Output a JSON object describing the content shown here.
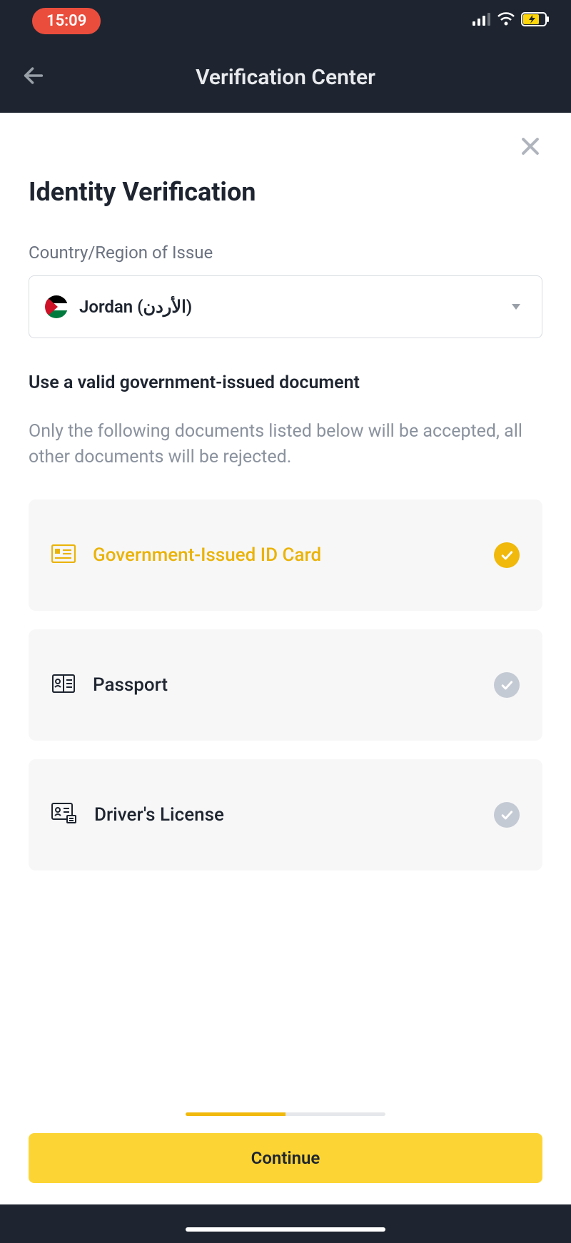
{
  "status_bar": {
    "time": "15:09"
  },
  "nav": {
    "title": "Verification Center"
  },
  "page": {
    "title": "Identity Verification",
    "country_label": "Country/Region of Issue",
    "country_value": "Jordan (الأردن)",
    "section_title": "Use a valid government-issued document",
    "section_desc": "Only the following documents listed below will be accepted, all other documents will be rejected."
  },
  "documents": [
    {
      "label": "Government-Issued ID Card",
      "selected": true
    },
    {
      "label": "Passport",
      "selected": false
    },
    {
      "label": "Driver's License",
      "selected": false
    }
  ],
  "footer": {
    "continue_label": "Continue",
    "progress_pct": 50
  },
  "colors": {
    "accent_yellow": "#fcd535",
    "brand_gold": "#f0b90b",
    "dark_bg": "#1e2530",
    "time_red": "#eb4d3d"
  }
}
